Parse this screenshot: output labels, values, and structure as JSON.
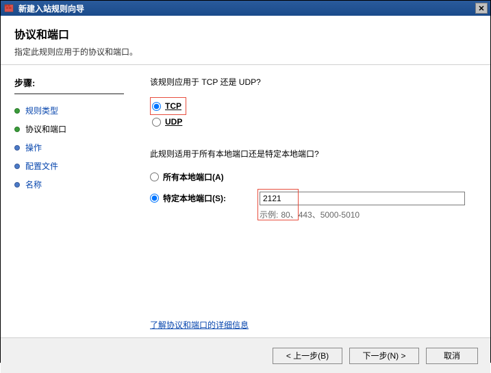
{
  "titlebar": {
    "text": "新建入站规则向导"
  },
  "header": {
    "title": "协议和端口",
    "desc": "指定此规则应用于的协议和端口。"
  },
  "sidebar": {
    "title": "步骤:",
    "items": [
      {
        "label": "规则类型",
        "bullet": "green"
      },
      {
        "label": "协议和端口",
        "bullet": "green",
        "current": true
      },
      {
        "label": "操作",
        "bullet": "blue"
      },
      {
        "label": "配置文件",
        "bullet": "blue"
      },
      {
        "label": "名称",
        "bullet": "blue"
      }
    ]
  },
  "main": {
    "q1": "该规则应用于 TCP 还是 UDP?",
    "tcp": "TCP",
    "udp": "UDP",
    "q2": "此规则适用于所有本地端口还是特定本地端口?",
    "all_ports": "所有本地端口(A)",
    "specific_ports": "特定本地端口(S):",
    "port_value": "2121",
    "hint_prefix": "示例:",
    "hint_text": "80、443、5000-5010",
    "link": "了解协议和端口的详细信息"
  },
  "footer": {
    "back": "< 上一步(B)",
    "next": "下一步(N) >",
    "cancel": "取消"
  }
}
